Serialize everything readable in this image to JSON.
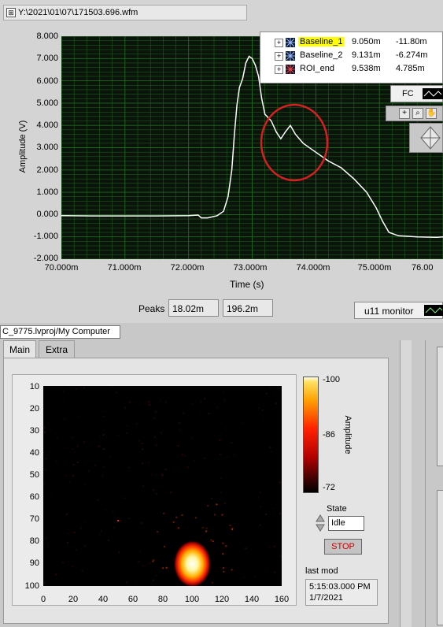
{
  "file_path": "Y:\\2021\\01\\07\\171503.696.wfm",
  "waveform_graph": {
    "y_label": "Amplitude (V)",
    "x_label": "Time (s)",
    "y_ticks": [
      "8.000",
      "7.000",
      "6.000",
      "5.000",
      "4.000",
      "3.000",
      "2.000",
      "1.000",
      "0.000",
      "-1.000",
      "-2.000"
    ],
    "x_ticks": [
      "70.000m",
      "71.000m",
      "72.000m",
      "73.000m",
      "74.000m",
      "75.000m",
      "76.00"
    ],
    "trace_color": "#ffffff",
    "grid_color": "#1f6a1f",
    "annotation_color": "#d42020"
  },
  "cursors": [
    {
      "name": "Baseline_1",
      "x": "9.050m",
      "y": "-11.80m",
      "highlight": "#ffff00",
      "marker_color": "#9ab8ff"
    },
    {
      "name": "Baseline_2",
      "x": "9.131m",
      "y": "-6.274m",
      "highlight": "",
      "marker_color": "#9ab8ff"
    },
    {
      "name": "ROI_end",
      "x": "9.538m",
      "y": "4.785m",
      "highlight": "",
      "marker_color": "#ff4040"
    }
  ],
  "plot_legend": {
    "label": "FC"
  },
  "peaks": {
    "label": "Peaks",
    "values": [
      "18.02m",
      "196.2m"
    ]
  },
  "monitor": {
    "label": "u11 monitor"
  },
  "project_path": "C_9775.lvproj/My Computer",
  "tabs": [
    "Main",
    "Extra"
  ],
  "intensity_graph": {
    "y_ticks": [
      "10",
      "20",
      "30",
      "40",
      "50",
      "60",
      "70",
      "80",
      "90",
      "100"
    ],
    "x_ticks": [
      "0",
      "20",
      "40",
      "60",
      "80",
      "100",
      "120",
      "140",
      "160"
    ],
    "colorbar_ticks": [
      "-100",
      "-86",
      "-72"
    ],
    "colorbar_label": "Amplitude",
    "hotspot": {
      "x": 100,
      "y": 90
    }
  },
  "state": {
    "label": "State",
    "value": "Idle"
  },
  "stop_button": {
    "label": "STOP"
  },
  "last_mod": {
    "label": "last mod",
    "time": "5:15:03.000 PM",
    "date": "1/7/2021"
  }
}
